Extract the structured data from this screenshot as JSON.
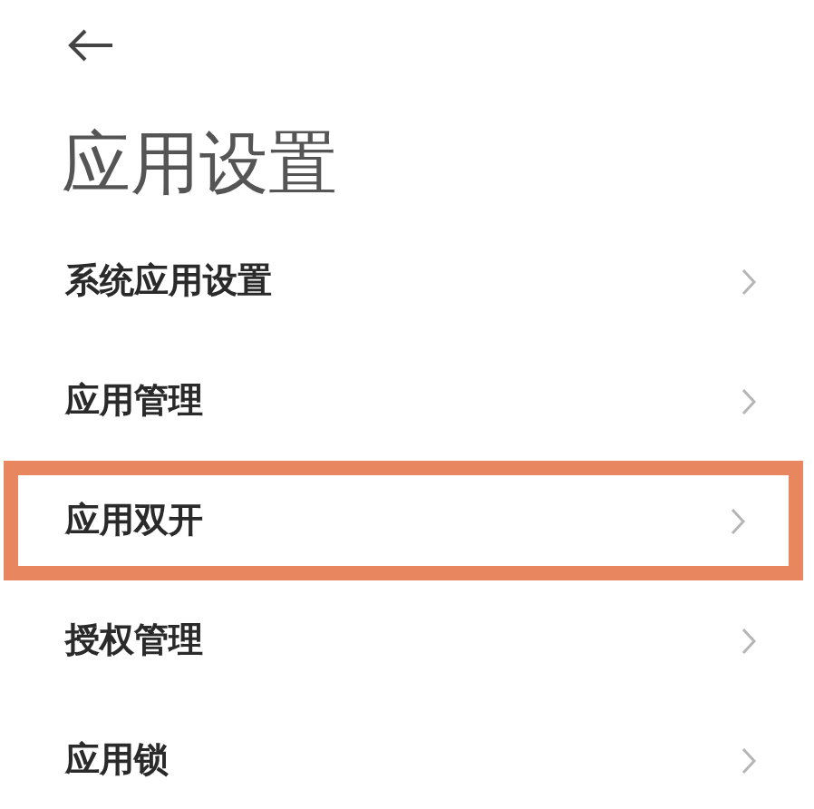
{
  "page": {
    "title": "应用设置"
  },
  "items": [
    {
      "label": "系统应用设置",
      "highlighted": false
    },
    {
      "label": "应用管理",
      "highlighted": false
    },
    {
      "label": "应用双开",
      "highlighted": true
    },
    {
      "label": "授权管理",
      "highlighted": false
    },
    {
      "label": "应用锁",
      "highlighted": false
    }
  ]
}
